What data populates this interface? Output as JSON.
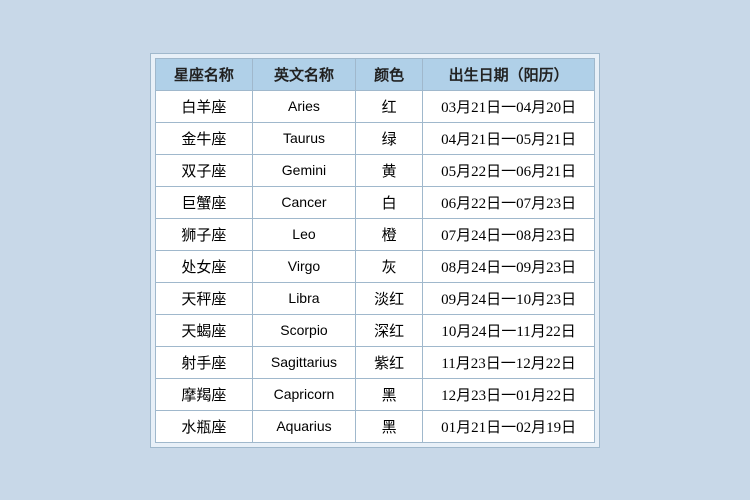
{
  "table": {
    "headers": [
      "星座名称",
      "英文名称",
      "颜色",
      "出生日期（阳历）"
    ],
    "rows": [
      {
        "cn": "白羊座",
        "en": "Aries",
        "color": "红",
        "date": "03月21日一04月20日"
      },
      {
        "cn": "金牛座",
        "en": "Taurus",
        "color": "绿",
        "date": "04月21日一05月21日"
      },
      {
        "cn": "双子座",
        "en": "Gemini",
        "color": "黄",
        "date": "05月22日一06月21日"
      },
      {
        "cn": "巨蟹座",
        "en": "Cancer",
        "color": "白",
        "date": "06月22日一07月23日"
      },
      {
        "cn": "狮子座",
        "en": "Leo",
        "color": "橙",
        "date": "07月24日一08月23日"
      },
      {
        "cn": "处女座",
        "en": "Virgo",
        "color": "灰",
        "date": "08月24日一09月23日"
      },
      {
        "cn": "天秤座",
        "en": "Libra",
        "color": "淡红",
        "date": "09月24日一10月23日"
      },
      {
        "cn": "天蝎座",
        "en": "Scorpio",
        "color": "深红",
        "date": "10月24日一11月22日"
      },
      {
        "cn": "射手座",
        "en": "Sagittarius",
        "color": "紫红",
        "date": "11月23日一12月22日"
      },
      {
        "cn": "摩羯座",
        "en": "Capricorn",
        "color": "黑",
        "date": "12月23日一01月22日"
      },
      {
        "cn": "水瓶座",
        "en": "Aquarius",
        "color": "黑",
        "date": "01月21日一02月19日"
      }
    ]
  }
}
